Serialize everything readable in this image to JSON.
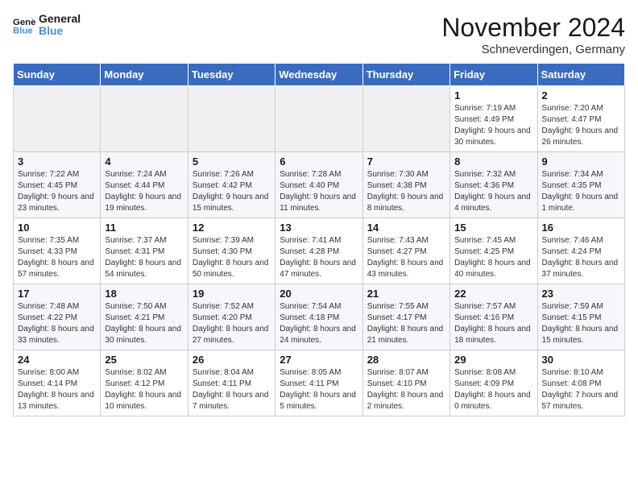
{
  "header": {
    "logo_general": "General",
    "logo_blue": "Blue",
    "month_title": "November 2024",
    "location": "Schneverdingen, Germany"
  },
  "weekdays": [
    "Sunday",
    "Monday",
    "Tuesday",
    "Wednesday",
    "Thursday",
    "Friday",
    "Saturday"
  ],
  "weeks": [
    [
      {
        "day": "",
        "info": ""
      },
      {
        "day": "",
        "info": ""
      },
      {
        "day": "",
        "info": ""
      },
      {
        "day": "",
        "info": ""
      },
      {
        "day": "",
        "info": ""
      },
      {
        "day": "1",
        "info": "Sunrise: 7:19 AM\nSunset: 4:49 PM\nDaylight: 9 hours and 30 minutes."
      },
      {
        "day": "2",
        "info": "Sunrise: 7:20 AM\nSunset: 4:47 PM\nDaylight: 9 hours and 26 minutes."
      }
    ],
    [
      {
        "day": "3",
        "info": "Sunrise: 7:22 AM\nSunset: 4:45 PM\nDaylight: 9 hours and 23 minutes."
      },
      {
        "day": "4",
        "info": "Sunrise: 7:24 AM\nSunset: 4:44 PM\nDaylight: 9 hours and 19 minutes."
      },
      {
        "day": "5",
        "info": "Sunrise: 7:26 AM\nSunset: 4:42 PM\nDaylight: 9 hours and 15 minutes."
      },
      {
        "day": "6",
        "info": "Sunrise: 7:28 AM\nSunset: 4:40 PM\nDaylight: 9 hours and 11 minutes."
      },
      {
        "day": "7",
        "info": "Sunrise: 7:30 AM\nSunset: 4:38 PM\nDaylight: 9 hours and 8 minutes."
      },
      {
        "day": "8",
        "info": "Sunrise: 7:32 AM\nSunset: 4:36 PM\nDaylight: 9 hours and 4 minutes."
      },
      {
        "day": "9",
        "info": "Sunrise: 7:34 AM\nSunset: 4:35 PM\nDaylight: 9 hours and 1 minute."
      }
    ],
    [
      {
        "day": "10",
        "info": "Sunrise: 7:35 AM\nSunset: 4:33 PM\nDaylight: 8 hours and 57 minutes."
      },
      {
        "day": "11",
        "info": "Sunrise: 7:37 AM\nSunset: 4:31 PM\nDaylight: 8 hours and 54 minutes."
      },
      {
        "day": "12",
        "info": "Sunrise: 7:39 AM\nSunset: 4:30 PM\nDaylight: 8 hours and 50 minutes."
      },
      {
        "day": "13",
        "info": "Sunrise: 7:41 AM\nSunset: 4:28 PM\nDaylight: 8 hours and 47 minutes."
      },
      {
        "day": "14",
        "info": "Sunrise: 7:43 AM\nSunset: 4:27 PM\nDaylight: 8 hours and 43 minutes."
      },
      {
        "day": "15",
        "info": "Sunrise: 7:45 AM\nSunset: 4:25 PM\nDaylight: 8 hours and 40 minutes."
      },
      {
        "day": "16",
        "info": "Sunrise: 7:46 AM\nSunset: 4:24 PM\nDaylight: 8 hours and 37 minutes."
      }
    ],
    [
      {
        "day": "17",
        "info": "Sunrise: 7:48 AM\nSunset: 4:22 PM\nDaylight: 8 hours and 33 minutes."
      },
      {
        "day": "18",
        "info": "Sunrise: 7:50 AM\nSunset: 4:21 PM\nDaylight: 8 hours and 30 minutes."
      },
      {
        "day": "19",
        "info": "Sunrise: 7:52 AM\nSunset: 4:20 PM\nDaylight: 8 hours and 27 minutes."
      },
      {
        "day": "20",
        "info": "Sunrise: 7:54 AM\nSunset: 4:18 PM\nDaylight: 8 hours and 24 minutes."
      },
      {
        "day": "21",
        "info": "Sunrise: 7:55 AM\nSunset: 4:17 PM\nDaylight: 8 hours and 21 minutes."
      },
      {
        "day": "22",
        "info": "Sunrise: 7:57 AM\nSunset: 4:16 PM\nDaylight: 8 hours and 18 minutes."
      },
      {
        "day": "23",
        "info": "Sunrise: 7:59 AM\nSunset: 4:15 PM\nDaylight: 8 hours and 15 minutes."
      }
    ],
    [
      {
        "day": "24",
        "info": "Sunrise: 8:00 AM\nSunset: 4:14 PM\nDaylight: 8 hours and 13 minutes."
      },
      {
        "day": "25",
        "info": "Sunrise: 8:02 AM\nSunset: 4:12 PM\nDaylight: 8 hours and 10 minutes."
      },
      {
        "day": "26",
        "info": "Sunrise: 8:04 AM\nSunset: 4:11 PM\nDaylight: 8 hours and 7 minutes."
      },
      {
        "day": "27",
        "info": "Sunrise: 8:05 AM\nSunset: 4:11 PM\nDaylight: 8 hours and 5 minutes."
      },
      {
        "day": "28",
        "info": "Sunrise: 8:07 AM\nSunset: 4:10 PM\nDaylight: 8 hours and 2 minutes."
      },
      {
        "day": "29",
        "info": "Sunrise: 8:08 AM\nSunset: 4:09 PM\nDaylight: 8 hours and 0 minutes."
      },
      {
        "day": "30",
        "info": "Sunrise: 8:10 AM\nSunset: 4:08 PM\nDaylight: 7 hours and 57 minutes."
      }
    ]
  ]
}
